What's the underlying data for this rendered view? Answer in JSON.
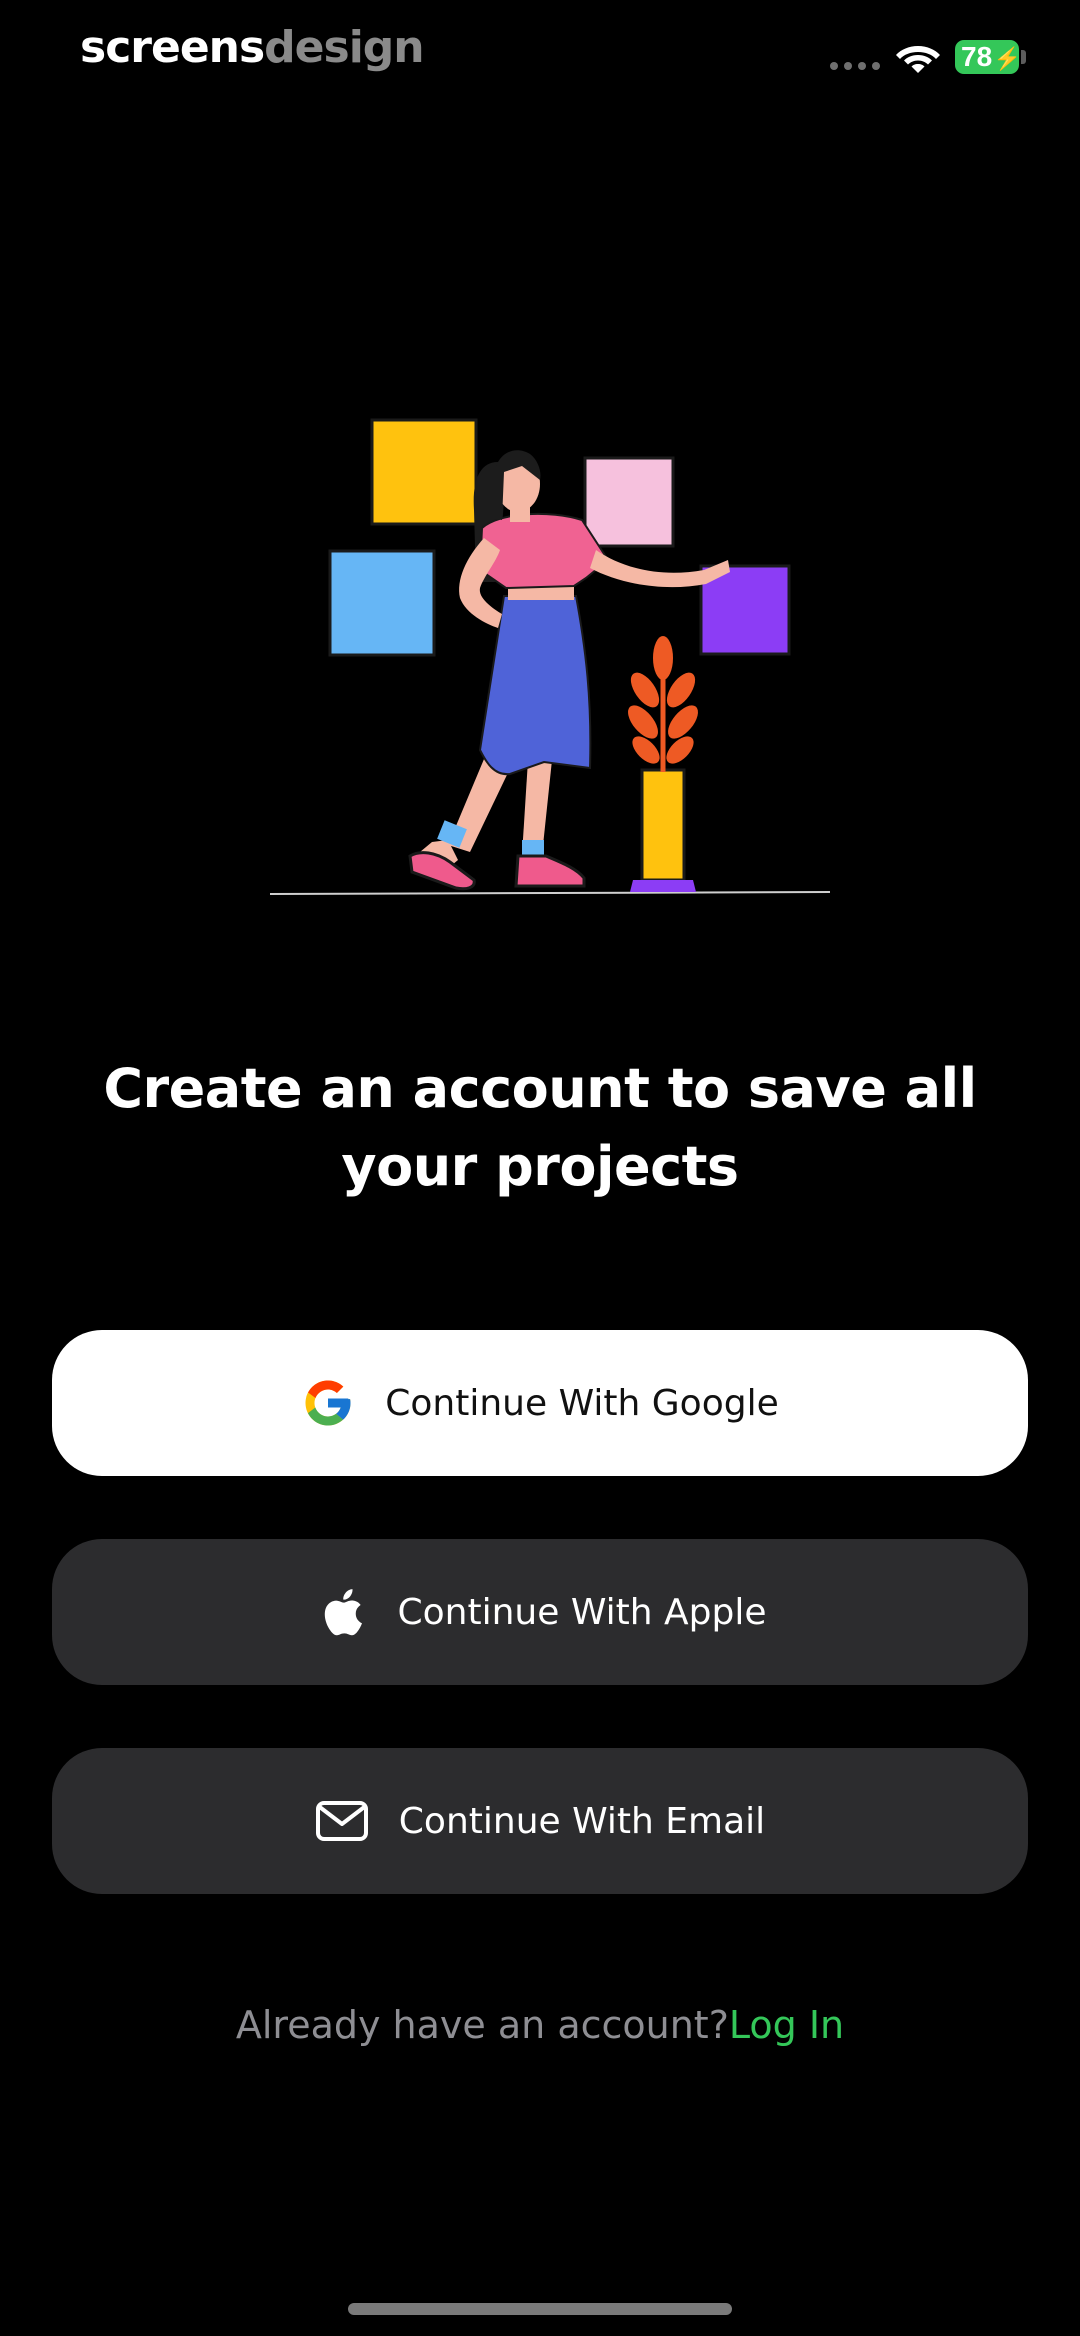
{
  "status_bar": {
    "brand_part1": "screens",
    "brand_part2": "design",
    "battery_level": "78",
    "icons": [
      "signal-dots-icon",
      "wifi-icon",
      "battery-icon"
    ]
  },
  "onboarding": {
    "heading": "Create an account to save all your projects",
    "buttons": {
      "google": {
        "label": "Continue With Google",
        "icon": "google-icon"
      },
      "apple": {
        "label": "Continue With Apple",
        "icon": "apple-icon"
      },
      "email": {
        "label": "Continue With Email",
        "icon": "mail-icon"
      }
    },
    "footer": {
      "prompt": "Already have an account?",
      "link": "Log In"
    }
  },
  "colors": {
    "background": "#000000",
    "primary_button": "#ffffff",
    "secondary_button": "#2c2c2e",
    "accent_link": "#34c759",
    "muted_text": "#8e8e93"
  }
}
